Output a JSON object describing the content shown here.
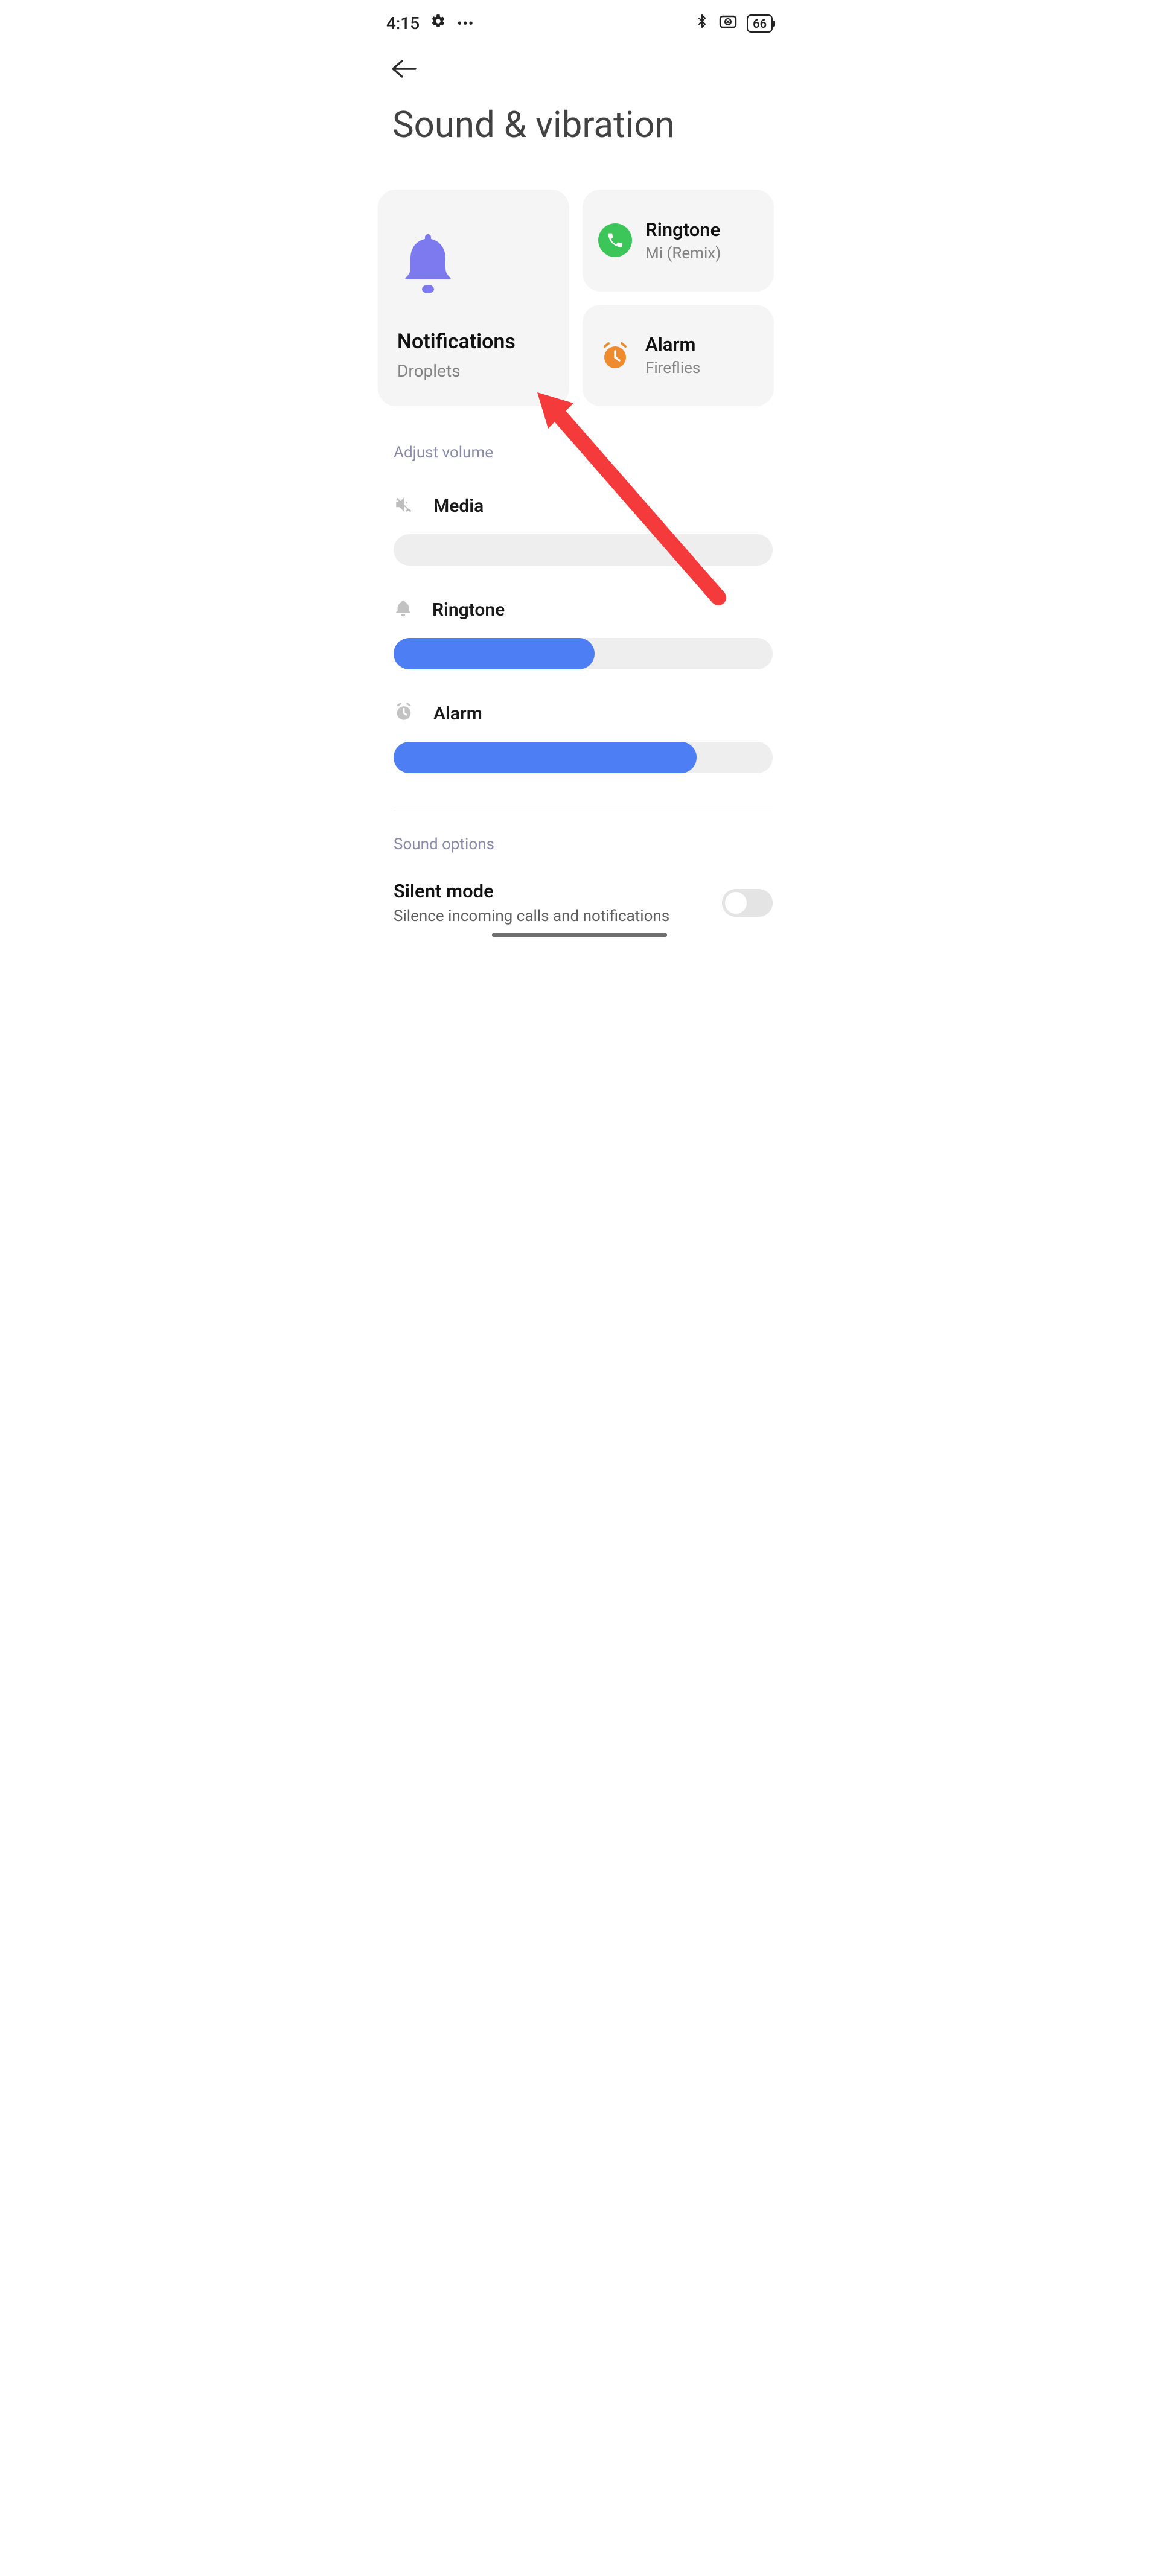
{
  "status": {
    "time": "4:15",
    "battery_text": "66"
  },
  "page": {
    "title": "Sound & vibration"
  },
  "cards": {
    "notifications": {
      "title": "Notifications",
      "sub": "Droplets"
    },
    "ringtone": {
      "title": "Ringtone",
      "sub": "Mi (Remix)"
    },
    "alarm": {
      "title": "Alarm",
      "sub": "Fireflies"
    }
  },
  "sections": {
    "adjust_volume": "Adjust volume",
    "sound_options": "Sound options"
  },
  "volume": {
    "media": {
      "label": "Media",
      "value_pct": 0
    },
    "ringtone": {
      "label": "Ringtone",
      "value_pct": 53
    },
    "alarm": {
      "label": "Alarm",
      "value_pct": 80
    }
  },
  "silent_mode": {
    "title": "Silent mode",
    "sub": "Silence incoming calls and notifications",
    "enabled": false
  }
}
